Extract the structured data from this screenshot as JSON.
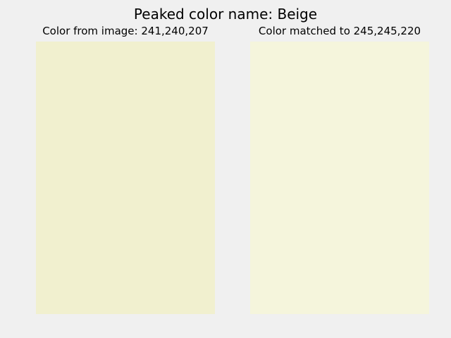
{
  "window": {
    "title": "Peaked color name: Beige"
  },
  "panels": [
    {
      "title": "Color from image: 241,240,207",
      "swatch_color": "#f1f0cf"
    },
    {
      "title": "Color matched to 245,245,220",
      "swatch_color": "#f5f5dc"
    }
  ],
  "colors": {
    "background": "#f0f0f0"
  }
}
